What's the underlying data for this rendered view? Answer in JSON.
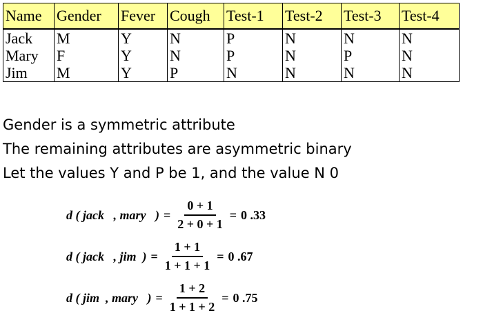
{
  "table": {
    "headers": [
      "Name",
      "Gender",
      "Fever",
      "Cough",
      "Test-1",
      "Test-2",
      "Test-3",
      "Test-4"
    ],
    "rows": [
      [
        "Jack",
        "M",
        "Y",
        "N",
        "P",
        "N",
        "N",
        "N"
      ],
      [
        "Mary",
        "F",
        "Y",
        "N",
        "P",
        "N",
        "P",
        "N"
      ],
      [
        "Jim",
        "M",
        "Y",
        "P",
        "N",
        "N",
        "N",
        "N"
      ]
    ]
  },
  "notes": [
    "Gender is a symmetric attribute",
    "The remaining attributes are asymmetric binary",
    "Let the values Y and P be 1, and the value N 0"
  ],
  "formulas": [
    {
      "lhs": "d ( jack   , mary   )",
      "numerator": "0 + 1",
      "denominator": "2 + 0 + 1",
      "result": "0 .33"
    },
    {
      "lhs": "d ( jack   , jim  )",
      "numerator": "1 + 1",
      "denominator": "1 + 1 + 1",
      "result": "0 .67"
    },
    {
      "lhs": "d ( jim  , mary   )",
      "numerator": "1 + 2",
      "denominator": "1 + 1 + 2",
      "result": "0 .75"
    }
  ]
}
